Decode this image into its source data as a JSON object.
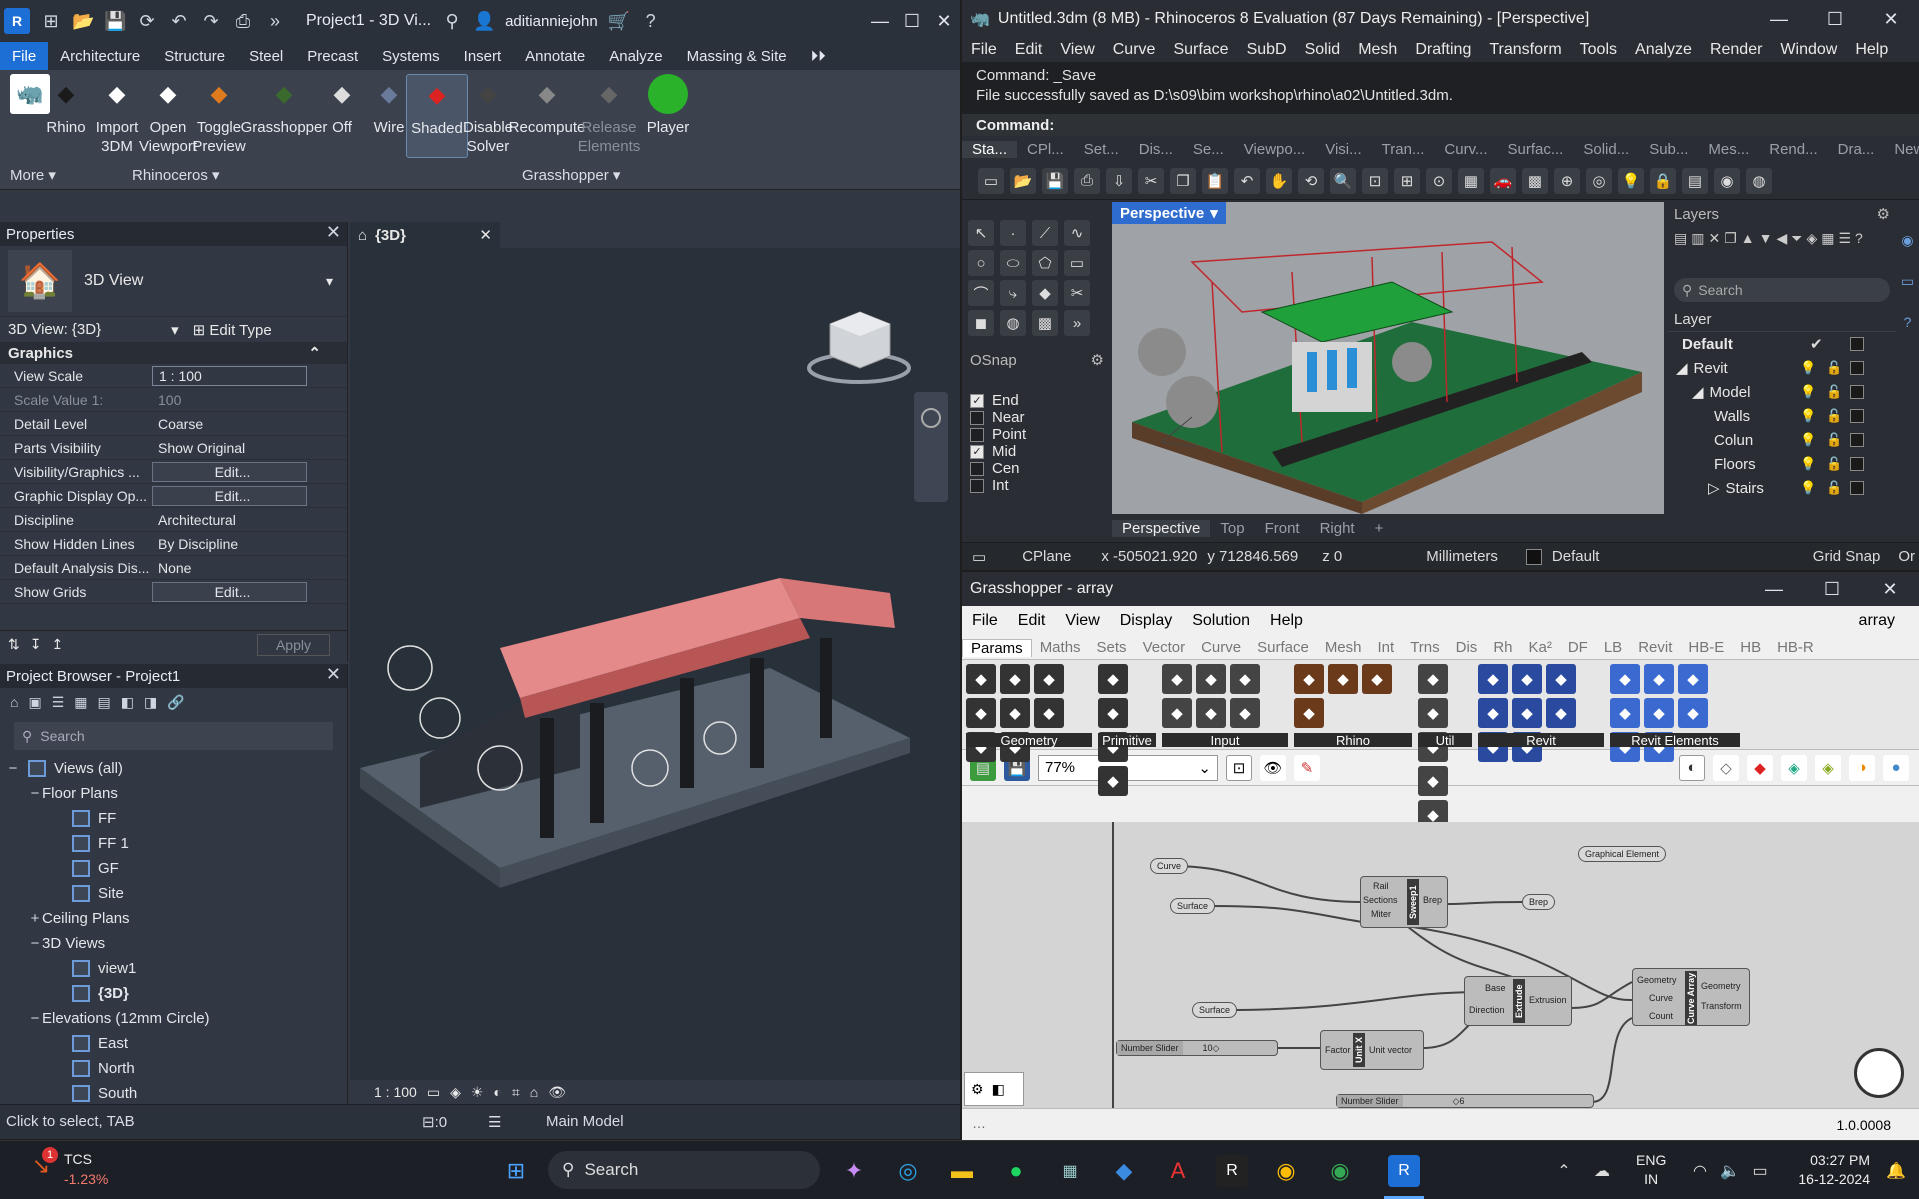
{
  "revit": {
    "title": "Project1 - 3D Vi...",
    "user": "aditianniejohn",
    "tabs": [
      "File",
      "Architecture",
      "Structure",
      "Steel",
      "Precast",
      "Systems",
      "Insert",
      "Annotate",
      "Analyze",
      "Massing & Site"
    ],
    "ribbon": {
      "more": "More",
      "group_rhinoceros": "Rhinoceros",
      "group_grasshopper": "Grasshopper",
      "buttons": [
        {
          "label": "Rhino",
          "icon": "rhino-icon"
        },
        {
          "label": "Import\n3DM",
          "icon": "import-3dm-icon"
        },
        {
          "label": "Open\nViewport",
          "icon": "open-viewport-icon"
        },
        {
          "label": "Toggle\nPreview",
          "icon": "toggle-preview-icon"
        },
        {
          "label": "Grasshopper",
          "icon": "grasshopper-icon"
        },
        {
          "label": "Off",
          "icon": "preview-off-icon"
        },
        {
          "label": "Wire",
          "icon": "wire-icon"
        },
        {
          "label": "Shaded",
          "icon": "shaded-icon"
        },
        {
          "label": "Disable\nSolver",
          "icon": "disable-solver-icon"
        },
        {
          "label": "Recompute",
          "icon": "recompute-icon"
        },
        {
          "label": "Release\nElements",
          "icon": "release-elements-icon"
        },
        {
          "label": "Player",
          "icon": "player-icon"
        }
      ]
    },
    "properties": {
      "title": "Properties",
      "type_name": "3D View",
      "selector": "3D View: {3D}",
      "edit_type": "Edit Type",
      "section": "Graphics",
      "rows": [
        {
          "k": "View Scale",
          "v": "1 : 100",
          "style": "box"
        },
        {
          "k": "Scale Value    1:",
          "v": "100",
          "style": "dim"
        },
        {
          "k": "Detail Level",
          "v": "Coarse",
          "style": ""
        },
        {
          "k": "Parts Visibility",
          "v": "Show Original",
          "style": ""
        },
        {
          "k": "Visibility/Graphics ...",
          "v": "Edit...",
          "style": "btn"
        },
        {
          "k": "Graphic Display Op...",
          "v": "Edit...",
          "style": "btn"
        },
        {
          "k": "Discipline",
          "v": "Architectural",
          "style": ""
        },
        {
          "k": "Show Hidden Lines",
          "v": "By Discipline",
          "style": ""
        },
        {
          "k": "Default Analysis Dis...",
          "v": "None",
          "style": ""
        },
        {
          "k": "Show Grids",
          "v": "Edit...",
          "style": "btn"
        }
      ],
      "apply": "Apply"
    },
    "browser": {
      "title": "Project Browser - Project1",
      "search_placeholder": "Search",
      "tree": [
        {
          "label": "Views (all)",
          "lvl": 0,
          "tg": "−",
          "icon": true
        },
        {
          "label": "Floor Plans",
          "lvl": 1,
          "tg": "−",
          "icon": false
        },
        {
          "label": "FF",
          "lvl": 2,
          "tg": "",
          "icon": true
        },
        {
          "label": "FF 1",
          "lvl": 2,
          "tg": "",
          "icon": true
        },
        {
          "label": "GF",
          "lvl": 2,
          "tg": "",
          "icon": true
        },
        {
          "label": "Site",
          "lvl": 2,
          "tg": "",
          "icon": true
        },
        {
          "label": "Ceiling Plans",
          "lvl": 1,
          "tg": "+",
          "icon": false
        },
        {
          "label": "3D Views",
          "lvl": 1,
          "tg": "−",
          "icon": false
        },
        {
          "label": "view1",
          "lvl": 2,
          "tg": "",
          "icon": true
        },
        {
          "label": "{3D}",
          "lvl": 2,
          "tg": "",
          "icon": true,
          "bold": true
        },
        {
          "label": "Elevations (12mm Circle)",
          "lvl": 1,
          "tg": "−",
          "icon": false
        },
        {
          "label": "East",
          "lvl": 2,
          "tg": "",
          "icon": true
        },
        {
          "label": "North",
          "lvl": 2,
          "tg": "",
          "icon": true
        },
        {
          "label": "South",
          "lvl": 2,
          "tg": "",
          "icon": true
        }
      ]
    },
    "view_tab": "{3D}",
    "view_scale": "1 : 100",
    "status_text": "Click to select, TAB",
    "status_count": ":0",
    "status_model": "Main Model"
  },
  "rhino": {
    "title": "Untitled.3dm (8 MB) - Rhinoceros 8 Evaluation (87 Days Remaining) - [Perspective]",
    "menu": [
      "File",
      "Edit",
      "View",
      "Curve",
      "Surface",
      "SubD",
      "Solid",
      "Mesh",
      "Drafting",
      "Transform",
      "Tools",
      "Analyze",
      "Render",
      "Window",
      "Help"
    ],
    "cmd_history": [
      "Command: _Save",
      "File successfully saved as D:\\s09\\bim workshop\\rhino\\a02\\Untitled.3dm."
    ],
    "cmd_prompt": "Command:",
    "toolbar_tabs": [
      "Sta...",
      "CPl...",
      "Set...",
      "Dis...",
      "Se...",
      "Viewpo...",
      "Visi...",
      "Tran...",
      "Curv...",
      "Surfac...",
      "Solid...",
      "Sub...",
      "Mes...",
      "Rend...",
      "Dra...",
      "New..."
    ],
    "osnap_title": "OSnap",
    "osnap": [
      {
        "label": "End",
        "checked": true
      },
      {
        "label": "Near",
        "checked": false
      },
      {
        "label": "Point",
        "checked": false
      },
      {
        "label": "Mid",
        "checked": true
      },
      {
        "label": "Cen",
        "checked": false
      },
      {
        "label": "Int",
        "checked": false
      }
    ],
    "viewport_label": "Perspective",
    "viewport_tabs": [
      "Perspective",
      "Top",
      "Front",
      "Right",
      "+"
    ],
    "layers_title": "Layers",
    "layers_search": "Search",
    "layers_header": "Layer",
    "layers": [
      {
        "name": "Default",
        "lvl": 0,
        "tg": "",
        "bold": true
      },
      {
        "name": "Revit",
        "lvl": 0,
        "tg": "◢"
      },
      {
        "name": "Model",
        "lvl": 1,
        "tg": "◢"
      },
      {
        "name": "Walls",
        "lvl": 2,
        "tg": ""
      },
      {
        "name": "Colun",
        "lvl": 2,
        "tg": ""
      },
      {
        "name": "Floors",
        "lvl": 2,
        "tg": ""
      },
      {
        "name": "Stairs",
        "lvl": 2,
        "tg": "▷"
      }
    ],
    "status": {
      "cplane": "CPlane",
      "x": "x -505021.920",
      "y": "y 712846.569",
      "z": "z 0",
      "units": "Millimeters",
      "layer": "Default",
      "gridsnap": "Grid Snap",
      "ortho": "Or"
    }
  },
  "grasshopper": {
    "title": "Grasshopper - array",
    "doc_name": "array",
    "menu": [
      "File",
      "Edit",
      "View",
      "Display",
      "Solution",
      "Help"
    ],
    "tabs": [
      "Params",
      "Maths",
      "Sets",
      "Vector",
      "Curve",
      "Surface",
      "Mesh",
      "Int",
      "Trns",
      "Dis",
      "Rh",
      "Ka²",
      "DF",
      "LB",
      "Revit",
      "HB-E",
      "HB",
      "HB-R"
    ],
    "groups": [
      "Geometry",
      "Primitive",
      "Input",
      "Rhino",
      "Util",
      "Revit",
      "Revit Elements"
    ],
    "zoom": "77%",
    "nodes": {
      "curve_param": "Curve",
      "surface_param": "Surface",
      "surface_param2": "Surface",
      "sweep_name": "Sweep1",
      "sweep_in": [
        "Rail",
        "Sections",
        "Miter"
      ],
      "sweep_out": "Brep",
      "brep_param": "Brep",
      "graphical_element": "Graphical Element",
      "extrude_name": "Extrude",
      "extrude_in": [
        "Base",
        "Direction"
      ],
      "extrude_out": "Extrusion",
      "unitx_name": "Unit X",
      "unitx_in": "Factor",
      "unitx_out": "Unit vector",
      "slider1_label": "Number Slider",
      "slider1_value": "10",
      "slider2_label": "Number Slider",
      "slider2_value": "6",
      "array_name": "Curve Array",
      "array_in": [
        "Geometry",
        "Curve",
        "Count"
      ],
      "array_out": [
        "Geometry",
        "Transform"
      ]
    },
    "status_version": "1.0.0008"
  },
  "taskbar": {
    "stock_name": "TCS",
    "stock_change": "-1.23%",
    "badge": "1",
    "search": "Search",
    "lang": "ENG",
    "region": "IN",
    "time": "03:27 PM",
    "date": "16-12-2024"
  }
}
